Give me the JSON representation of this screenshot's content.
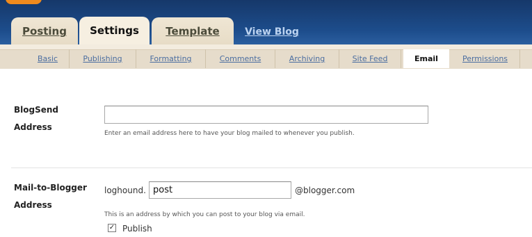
{
  "tabs": {
    "posting": "Posting",
    "settings": "Settings",
    "template": "Template",
    "view_blog": "View Blog"
  },
  "subnav": [
    {
      "label": "Basic",
      "active": false
    },
    {
      "label": "Publishing",
      "active": false
    },
    {
      "label": "Formatting",
      "active": false
    },
    {
      "label": "Comments",
      "active": false
    },
    {
      "label": "Archiving",
      "active": false
    },
    {
      "label": "Site Feed",
      "active": false
    },
    {
      "label": "Email",
      "active": true
    },
    {
      "label": "Permissions",
      "active": false
    }
  ],
  "blogsend": {
    "label_line1": "BlogSend",
    "label_line2": "Address",
    "value": "",
    "hint": "Enter an email address here to have your blog mailed to whenever you publish."
  },
  "mail_to_blogger": {
    "label_line1": "Mail-to-Blogger",
    "label_line2": "Address",
    "prefix": "loghound.",
    "value": "post",
    "suffix": "@blogger.com",
    "hint": "This is an address by which you can post to your blog via email.",
    "publish_label": "Publish",
    "publish_checked": true,
    "check_mark": "✓"
  },
  "colors": {
    "topbar": "#1d4d8c",
    "tab_bg": "#efe6d4",
    "link": "#4a6da0",
    "accent_orange": "#f08a1d"
  }
}
